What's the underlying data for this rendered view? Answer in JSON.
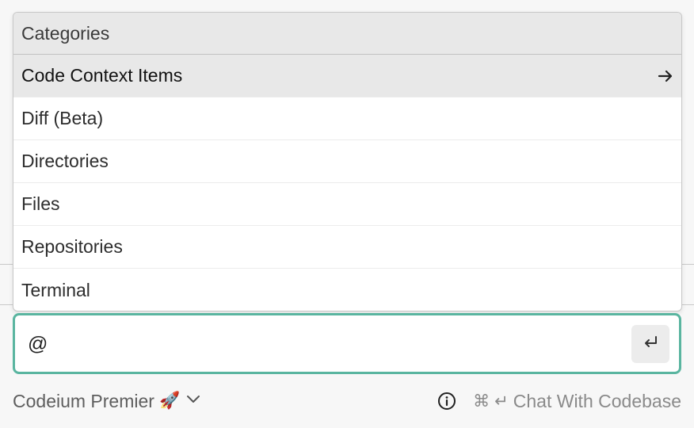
{
  "dropdown": {
    "header": "Categories",
    "items": [
      {
        "label": "Code Context Items",
        "active": true,
        "icon": "arrow-right-icon"
      },
      {
        "label": "Diff (Beta)"
      },
      {
        "label": "Directories"
      },
      {
        "label": "Files"
      },
      {
        "label": "Repositories"
      },
      {
        "label": "Terminal"
      }
    ]
  },
  "input": {
    "value": "@",
    "send_icon": "enter-icon"
  },
  "footer": {
    "model_label": "Codeium Premier",
    "model_emoji": "🚀",
    "cmd_symbol": "⌘",
    "enter_symbol": "↵",
    "codebase_label": "Chat With Codebase"
  },
  "colors": {
    "accent_border": "#5ab5a0",
    "active_item_bg": "#e8e8e8"
  }
}
